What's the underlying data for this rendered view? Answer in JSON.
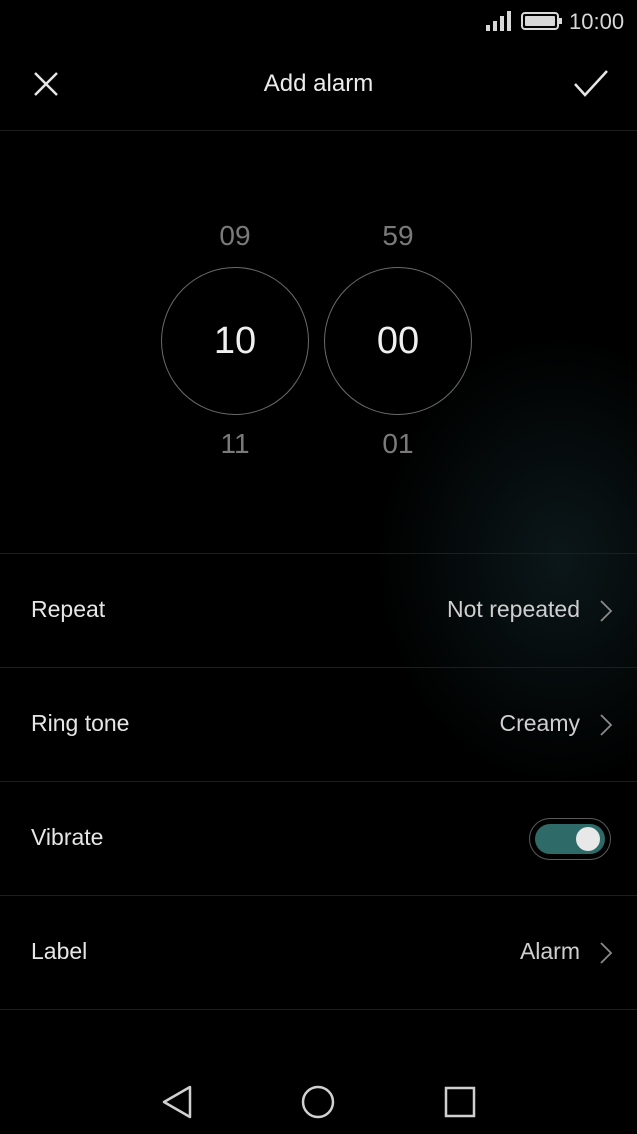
{
  "status_bar": {
    "time": "10:00",
    "signal_icon": "signal-icon",
    "battery_icon": "battery-icon"
  },
  "header": {
    "title": "Add alarm",
    "close_icon": "close-icon",
    "confirm_icon": "check-icon"
  },
  "picker": {
    "hours": {
      "prev": "09",
      "selected": "10",
      "next": "11"
    },
    "minutes": {
      "prev": "59",
      "selected": "00",
      "next": "01"
    }
  },
  "settings": {
    "repeat": {
      "label": "Repeat",
      "value": "Not repeated"
    },
    "ring_tone": {
      "label": "Ring tone",
      "value": "Creamy"
    },
    "vibrate": {
      "label": "Vibrate",
      "on": true
    },
    "label": {
      "label": "Label",
      "value": "Alarm"
    }
  },
  "colors": {
    "background": "#000000",
    "toggle_on": "#2e6b68",
    "text": "#e6e6e6"
  },
  "navbar": {
    "back_icon": "back-icon",
    "home_icon": "home-icon",
    "recent_icon": "recent-apps-icon"
  }
}
